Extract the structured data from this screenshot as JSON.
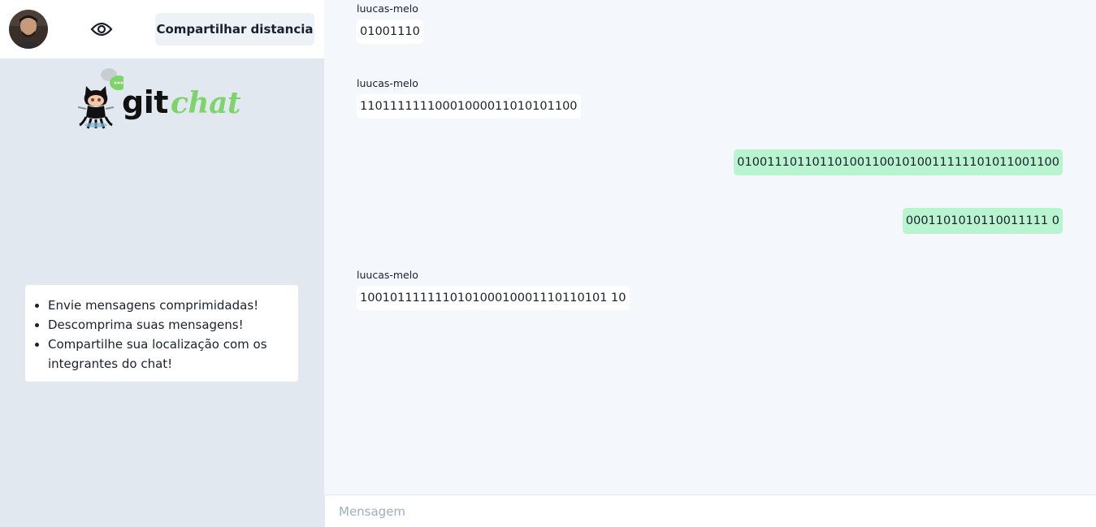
{
  "sidebar": {
    "share_button_label": "Compartilhar distancia",
    "logo": {
      "word1": "git",
      "word2": "chat"
    },
    "features": [
      "Envie mensagens comprimidadas!",
      "Descomprima suas mensagens!",
      "Compartilhe sua localização com os integrantes do chat!"
    ]
  },
  "messages": [
    {
      "direction": "in",
      "sender": "luucas-melo",
      "text": "01001110"
    },
    {
      "direction": "in",
      "sender": "luucas-melo",
      "text": "11011111110001000011010101100"
    },
    {
      "direction": "out",
      "text": "0100111011011010011001010011111101011001100"
    },
    {
      "direction": "out",
      "text": "0001101010110011111 0"
    },
    {
      "direction": "in",
      "sender": "luucas-melo",
      "text": "100101111111010100010001110110101 10"
    }
  ],
  "composer": {
    "placeholder": "Mensagem",
    "value": ""
  },
  "colors": {
    "sidebar_bg": "#e2e8f0",
    "chat_bg": "#f4f7fb",
    "outgoing_bubble": "#b7f4cf",
    "logo_green": "#7ed46a"
  }
}
